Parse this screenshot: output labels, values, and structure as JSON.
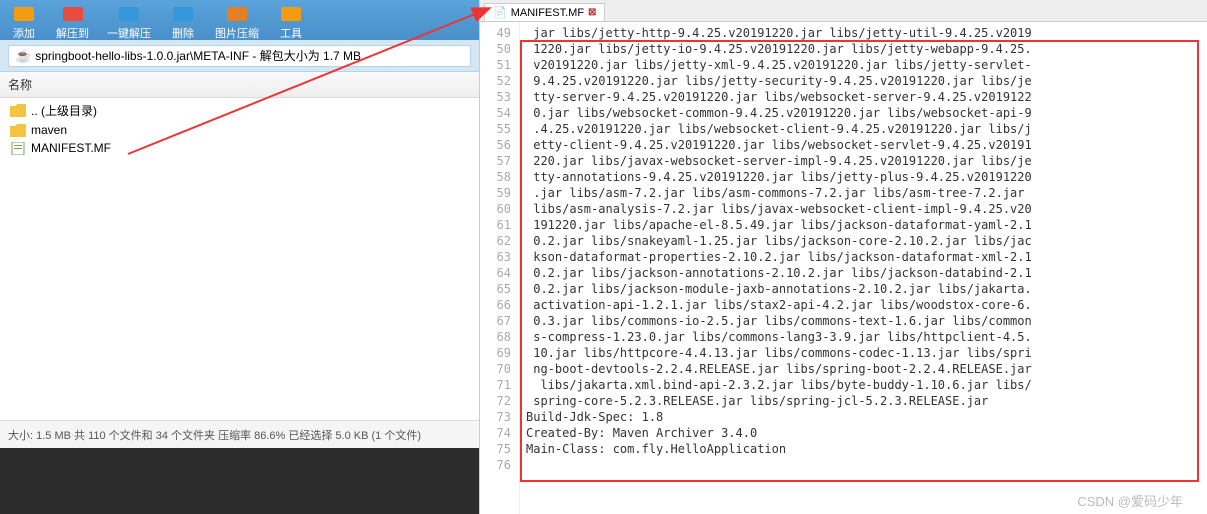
{
  "toolbar": [
    {
      "label": "添加",
      "color": "#f39c12"
    },
    {
      "label": "解压到",
      "color": "#e74c3c"
    },
    {
      "label": "一键解压",
      "color": "#3498db"
    },
    {
      "label": "删除",
      "color": "#3498db"
    },
    {
      "label": "图片压缩",
      "color": "#e67e22"
    },
    {
      "label": "工具",
      "color": "#f39c12"
    }
  ],
  "path_icon": "☕",
  "path_text": "springboot-hello-libs-1.0.0.jar\\META-INF - 解包大小为 1.7 MB",
  "name_header": "名称",
  "files": [
    {
      "icon": "folder",
      "label": ".. (上级目录)",
      "color": "#f5c242"
    },
    {
      "icon": "folder",
      "label": "maven",
      "color": "#f5c242"
    },
    {
      "icon": "file",
      "label": "MANIFEST.MF",
      "color": "#7aa35a"
    }
  ],
  "status_text": "大小: 1.5 MB 共 110 个文件和 34 个文件夹 压缩率 86.6% 已经选择 5.0 KB (1 个文件)",
  "tab": {
    "name": "MANIFEST.MF",
    "icon": "📄"
  },
  "line_start": 49,
  "line_end": 76,
  "code_lines": [
    " jar libs/jetty-http-9.4.25.v20191220.jar libs/jetty-util-9.4.25.v2019",
    " 1220.jar libs/jetty-io-9.4.25.v20191220.jar libs/jetty-webapp-9.4.25.",
    " v20191220.jar libs/jetty-xml-9.4.25.v20191220.jar libs/jetty-servlet-",
    " 9.4.25.v20191220.jar libs/jetty-security-9.4.25.v20191220.jar libs/je",
    " tty-server-9.4.25.v20191220.jar libs/websocket-server-9.4.25.v2019122",
    " 0.jar libs/websocket-common-9.4.25.v20191220.jar libs/websocket-api-9",
    " .4.25.v20191220.jar libs/websocket-client-9.4.25.v20191220.jar libs/j",
    " etty-client-9.4.25.v20191220.jar libs/websocket-servlet-9.4.25.v20191",
    " 220.jar libs/javax-websocket-server-impl-9.4.25.v20191220.jar libs/je",
    " tty-annotations-9.4.25.v20191220.jar libs/jetty-plus-9.4.25.v20191220",
    " .jar libs/asm-7.2.jar libs/asm-commons-7.2.jar libs/asm-tree-7.2.jar ",
    " libs/asm-analysis-7.2.jar libs/javax-websocket-client-impl-9.4.25.v20",
    " 191220.jar libs/apache-el-8.5.49.jar libs/jackson-dataformat-yaml-2.1",
    " 0.2.jar libs/snakeyaml-1.25.jar libs/jackson-core-2.10.2.jar libs/jac",
    " kson-dataformat-properties-2.10.2.jar libs/jackson-dataformat-xml-2.1",
    " 0.2.jar libs/jackson-annotations-2.10.2.jar libs/jackson-databind-2.1",
    " 0.2.jar libs/jackson-module-jaxb-annotations-2.10.2.jar libs/jakarta.",
    " activation-api-1.2.1.jar libs/stax2-api-4.2.jar libs/woodstox-core-6.",
    " 0.3.jar libs/commons-io-2.5.jar libs/commons-text-1.6.jar libs/common",
    " s-compress-1.23.0.jar libs/commons-lang3-3.9.jar libs/httpclient-4.5.",
    " 10.jar libs/httpcore-4.4.13.jar libs/commons-codec-1.13.jar libs/spri",
    " ng-boot-devtools-2.2.4.RELEASE.jar libs/spring-boot-2.2.4.RELEASE.jar",
    "  libs/jakarta.xml.bind-api-2.3.2.jar libs/byte-buddy-1.10.6.jar libs/",
    " spring-core-5.2.3.RELEASE.jar libs/spring-jcl-5.2.3.RELEASE.jar",
    "Build-Jdk-Spec: 1.8",
    "Created-By: Maven Archiver 3.4.0",
    "Main-Class: com.fly.HelloApplication",
    ""
  ],
  "watermark": "CSDN @爱码少年"
}
